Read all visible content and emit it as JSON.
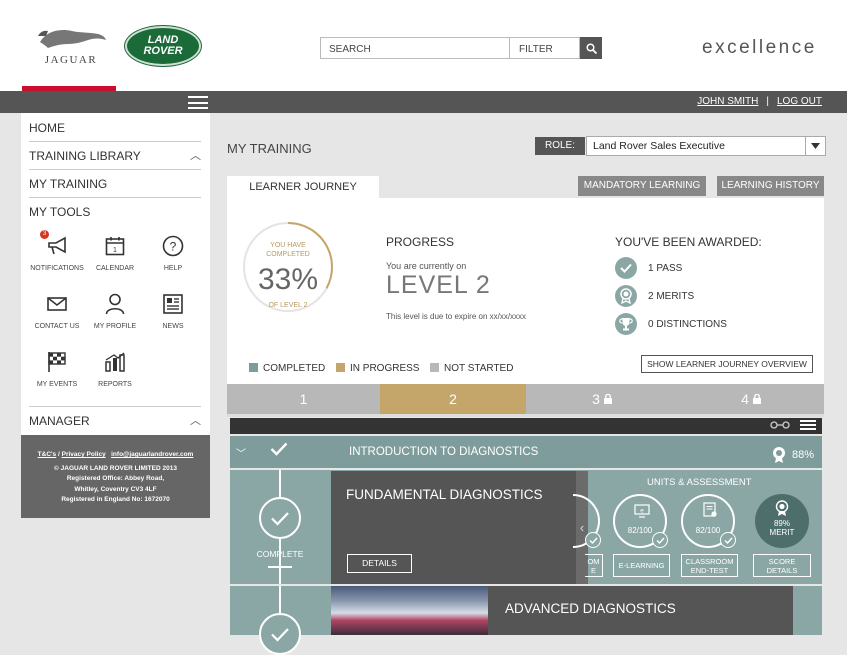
{
  "header": {
    "jaguar_label": "JAGUAR",
    "landrover_line1": "LAND",
    "landrover_line2": "ROVER",
    "search_placeholder": "SEARCH",
    "filter_label": "FILTER",
    "brand": "excellence"
  },
  "topbar": {
    "user_name": "JOHN SMITH",
    "separator": "|",
    "logout": "LOG OUT"
  },
  "sidebar": {
    "home": "HOME",
    "training_library": "TRAINING LIBRARY",
    "my_training": "MY TRAINING",
    "my_tools": "MY TOOLS",
    "manager": "MANAGER",
    "tools": {
      "notifications": "NOTIFICATIONS",
      "notifications_count": "3",
      "calendar": "CALENDAR",
      "help": "HELP",
      "contact_us": "CONTACT US",
      "my_profile": "MY PROFILE",
      "news": "NEWS",
      "my_events": "MY EVENTS",
      "reports": "REPORTS"
    }
  },
  "footer": {
    "tcs": "T&C's",
    "slash": " / ",
    "privacy": "Privacy Policy",
    "email": "info@jaguarlandrover.com",
    "line1": "© JAGUAR LAND ROVER LIMITED 2013",
    "line2": "Registered Office: Abbey Road,",
    "line3": "Whitley, Coventry CV3 4LF",
    "line4": "Registered in England No: 1672070"
  },
  "main": {
    "title": "MY TRAINING",
    "role_label": "ROLE:",
    "role_value": "Land Rover Sales Executive",
    "tab_learner_journey": "LEARNER JOURNEY",
    "btn_mandatory": "MANDATORY LEARNING",
    "btn_history": "LEARNING HISTORY"
  },
  "progress": {
    "ring_top1": "YOU HAVE",
    "ring_top2": "COMPLETED",
    "percent": "33%",
    "percent_value": 0.33,
    "ring_bottom": "OF LEVEL 2",
    "heading": "PROGRESS",
    "currently": "You are currently on",
    "level": "LEVEL 2",
    "expiry": "This level is due to expire on xx/xx/xxxx"
  },
  "awards": {
    "heading": "YOU'VE BEEN AWARDED:",
    "pass": "1 PASS",
    "merits": "2 MERITS",
    "distinctions": "0 DISTINCTIONS"
  },
  "legend": {
    "completed": "COMPLETED",
    "in_progress": "IN PROGRESS",
    "not_started": "NOT STARTED",
    "overview_button": "SHOW LEARNER JOURNEY OVERVIEW",
    "colors": {
      "completed": "#7d9c9b",
      "in_progress": "#c4a66b",
      "not_started": "#b8b8b8"
    }
  },
  "levels": [
    "1",
    "2",
    "3",
    "4"
  ],
  "course": {
    "intro_title": "INTRODUCTION TO DIAGNOSTICS",
    "intro_percent": "88%",
    "module_title": "FUNDAMENTAL DIAGNOSTICS",
    "status": "COMPLETE",
    "details": "DETAILS",
    "units_heading": "UNITS & ASSESSMENT",
    "partial_btn_1": "OM",
    "partial_btn_2": "E",
    "score_elearning": "82/100",
    "score_classroom": "82/100",
    "elearning": "E-LEARNING",
    "classroom_1": "CLASSROOM",
    "classroom_2": "END-TEST",
    "merit_percent": "89%",
    "merit_label": "MERIT",
    "score_1": "SCORE",
    "score_2": "DETAILS",
    "next_title": "ADVANCED DIAGNOSTICS"
  }
}
